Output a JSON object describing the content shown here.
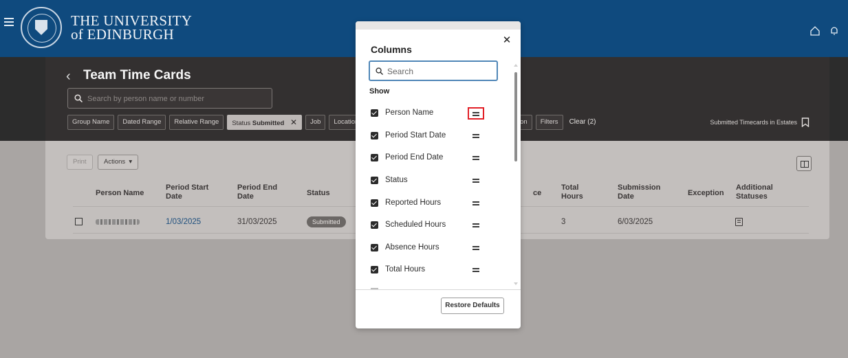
{
  "header": {
    "university_line1": "THE UNIVERSITY",
    "university_line2": "of EDINBURGH"
  },
  "page": {
    "title": "Team Time Cards",
    "search_placeholder": "Search by person name or number"
  },
  "filters": {
    "chips": [
      "Group Name",
      "Dated Range",
      "Relative Range"
    ],
    "active_chip_prefix": "Status",
    "active_chip_value": "Submitted",
    "more_chips": [
      "Job",
      "Location"
    ],
    "right_chips": [
      "ion",
      "Filters"
    ],
    "clear": "Clear (2)",
    "saved_search": "Submitted Timecards in Estates"
  },
  "toolbar": {
    "print": "Print",
    "actions": "Actions"
  },
  "table": {
    "headers": {
      "person_name": "Person Name",
      "period_start": "Period Start Date",
      "period_end": "Period End Date",
      "status": "Status",
      "absence_partial": "ce",
      "total_hours": "Total Hours",
      "submission_date": "Submission Date",
      "exception": "Exception",
      "additional_statuses": "Additional Statuses"
    },
    "rows": [
      {
        "period_start": "1/03/2025",
        "period_end": "31/03/2025",
        "status": "Submitted",
        "total_hours": "3",
        "submission_date": "6/03/2025"
      }
    ]
  },
  "columns_dialog": {
    "title": "Columns",
    "search_placeholder": "Search",
    "section_label": "Show",
    "items": [
      {
        "label": "Person Name",
        "checked": true
      },
      {
        "label": "Period Start Date",
        "checked": true
      },
      {
        "label": "Period End Date",
        "checked": true
      },
      {
        "label": "Status",
        "checked": true
      },
      {
        "label": "Reported Hours",
        "checked": true
      },
      {
        "label": "Scheduled Hours",
        "checked": true
      },
      {
        "label": "Absence Hours",
        "checked": true
      },
      {
        "label": "Total Hours",
        "checked": true
      }
    ],
    "restore_defaults": "Restore Defaults",
    "highlight_color": "#e21f26"
  },
  "colors": {
    "brand_blue": "#0f4a7e",
    "focus_blue": "#4f86b7",
    "link_blue": "#1e4f7d"
  }
}
